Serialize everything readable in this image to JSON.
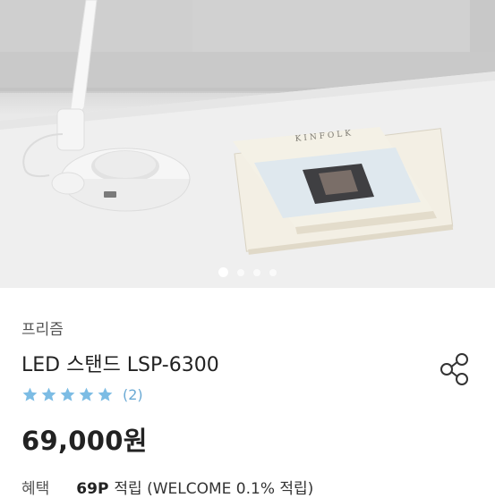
{
  "gallery": {
    "book_cover_title": "KINFOLK",
    "total_slides": 4,
    "active_slide": 1
  },
  "product": {
    "brand": "프리즘",
    "title": "LED 스탠드 LSP-6300",
    "rating_stars": 5,
    "review_count": "(2)",
    "price": "69,000원"
  },
  "benefit": {
    "label": "혜택",
    "points": "69P",
    "text": "적립 (WELCOME 0.1% 적립)"
  },
  "colors": {
    "star": "#7cbce4",
    "review_count": "#6aa9d4"
  },
  "icons": {
    "share": "share-icon",
    "star": "star-icon"
  }
}
